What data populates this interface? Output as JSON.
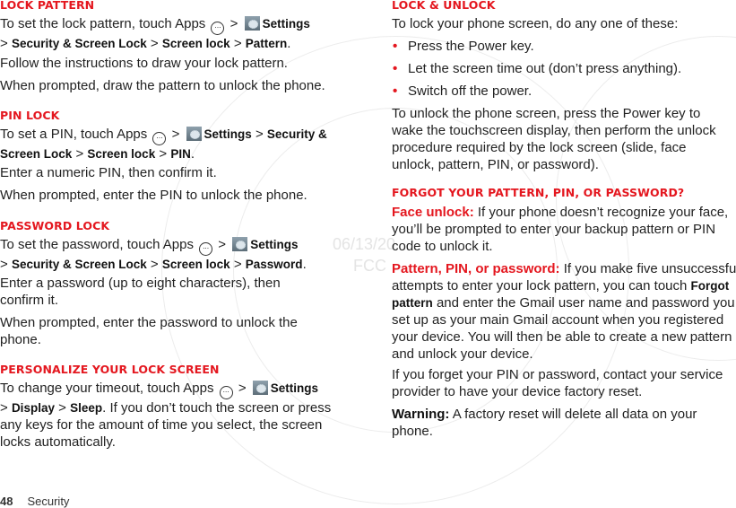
{
  "page": {
    "number": "48",
    "section": "Security"
  },
  "icons": {
    "apps": "apps-icon",
    "settings": "settings-icon"
  },
  "left": {
    "lock_pattern": {
      "heading": "Lock pattern",
      "p1_a": "To set the lock pattern, touch Apps",
      "p1_settings": "Settings",
      "p1_path": [
        "Security & Screen Lock",
        "Screen lock",
        "Pattern"
      ],
      "p2": "Follow the instructions to draw your lock pattern.",
      "p3": "When prompted, draw the pattern to unlock the phone."
    },
    "pin_lock": {
      "heading": "PIN lock",
      "p1_a": "To set a PIN, touch Apps",
      "p1_settings": "Settings",
      "p1_path": [
        "Security & Screen Lock",
        "Screen lock",
        "PIN"
      ],
      "p2": "Enter a numeric PIN, then confirm it.",
      "p3": "When prompted, enter the PIN to unlock the phone."
    },
    "password_lock": {
      "heading": "Password lock",
      "p1_a": "To set the password, touch Apps",
      "p1_settings": "Settings",
      "p1_path": [
        "Security & Screen Lock",
        "Screen lock",
        "Password"
      ],
      "p2": "Enter a password (up to eight characters), then confirm it.",
      "p3": "When prompted, enter the password to unlock the phone."
    },
    "personalize": {
      "heading": "Personalize your lock screen",
      "p1_a": "To change your timeout, touch Apps",
      "p1_settings": "Settings",
      "p1_path": [
        "Display",
        "Sleep"
      ],
      "p1_b": "If you don’t touch the screen or press any keys for the amount of time you select, the screen locks automatically."
    }
  },
  "right": {
    "lock_unlock": {
      "heading": "Lock & unlock",
      "intro": "To lock your phone screen, do any one of these:",
      "bullets": [
        "Press the Power key.",
        "Let the screen time out (don’t press anything).",
        "Switch off the power."
      ],
      "p2": "To unlock the phone screen, press the Power key to wake the touchscreen display, then perform the unlock procedure required by the lock screen (slide, face unlock, pattern, PIN, or password)."
    },
    "forgot": {
      "heading": "Forgot your pattern, PIN, or password?",
      "face_label": "Face unlock:",
      "face_text": "If your phone doesn’t recognize your face, you’ll be prompted to enter your backup pattern or PIN code to unlock it.",
      "pattern_label": "Pattern, PIN, or password:",
      "pattern_text_a": "If you make five unsuccessful attempts to enter your lock pattern, you can touch",
      "pattern_kw": "Forgot pattern",
      "pattern_text_b": "and enter the Gmail user name and password you set up as your main Gmail account when you registered your device. You will then be able to create a new pattern and unlock your device.",
      "p3": "If you forget your PIN or password, contact your service provider to have your device factory reset.",
      "warning_label": "Warning:",
      "warning_text": "A factory reset will delete all data on your phone."
    }
  },
  "watermark": {
    "date": "06/13/20",
    "agency": "FCC"
  }
}
